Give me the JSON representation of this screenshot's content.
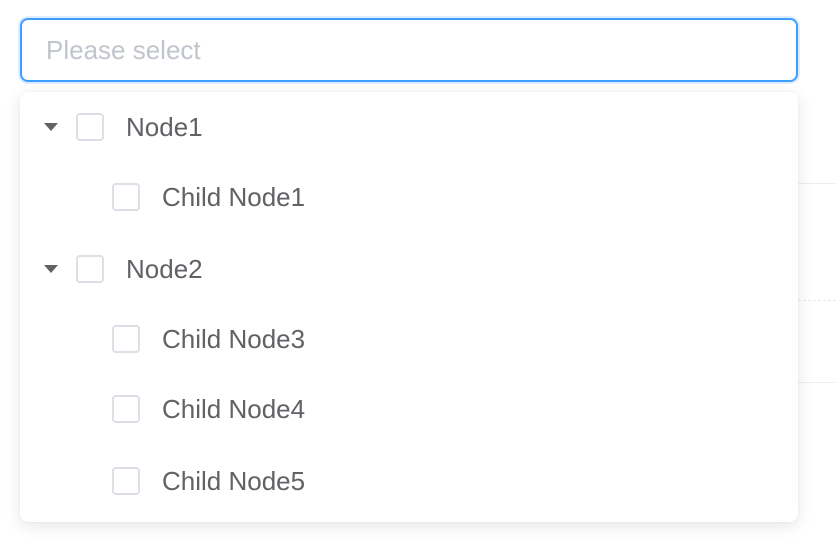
{
  "select": {
    "placeholder": "Please select",
    "value": ""
  },
  "tree": {
    "nodes": [
      {
        "label": "Node1",
        "expanded": true,
        "checked": false
      },
      {
        "label": "Child Node1",
        "checked": false
      },
      {
        "label": "Node2",
        "expanded": true,
        "checked": false
      },
      {
        "label": "Child Node3",
        "checked": false
      },
      {
        "label": "Child Node4",
        "checked": false
      },
      {
        "label": "Child Node5",
        "checked": false
      }
    ]
  },
  "colors": {
    "focus_border": "#409eff",
    "text": "#606266",
    "placeholder": "#c0c4cc",
    "checkbox_border": "#dcdfe6"
  }
}
